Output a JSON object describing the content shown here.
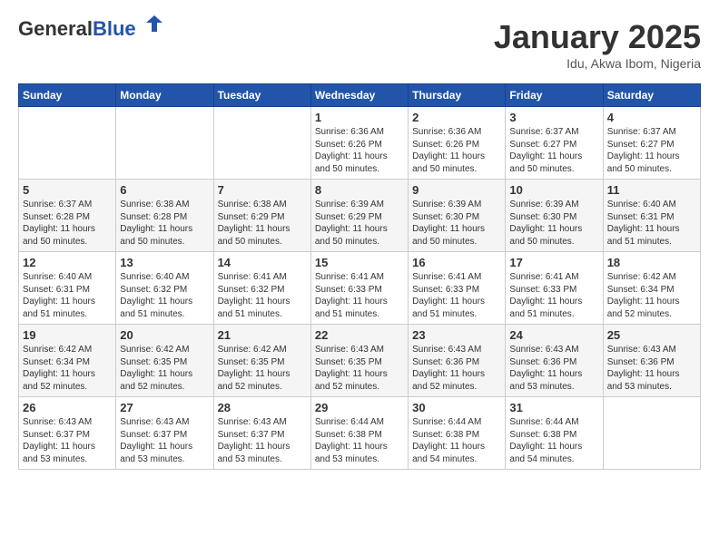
{
  "header": {
    "logo_general": "General",
    "logo_blue": "Blue",
    "title": "January 2025",
    "subtitle": "Idu, Akwa Ibom, Nigeria"
  },
  "weekdays": [
    "Sunday",
    "Monday",
    "Tuesday",
    "Wednesday",
    "Thursday",
    "Friday",
    "Saturday"
  ],
  "rows": [
    [
      null,
      null,
      null,
      {
        "day": "1",
        "sunrise": "6:36 AM",
        "sunset": "6:26 PM",
        "daylight": "11 hours and 50 minutes."
      },
      {
        "day": "2",
        "sunrise": "6:36 AM",
        "sunset": "6:26 PM",
        "daylight": "11 hours and 50 minutes."
      },
      {
        "day": "3",
        "sunrise": "6:37 AM",
        "sunset": "6:27 PM",
        "daylight": "11 hours and 50 minutes."
      },
      {
        "day": "4",
        "sunrise": "6:37 AM",
        "sunset": "6:27 PM",
        "daylight": "11 hours and 50 minutes."
      }
    ],
    [
      {
        "day": "5",
        "sunrise": "6:37 AM",
        "sunset": "6:28 PM",
        "daylight": "11 hours and 50 minutes."
      },
      {
        "day": "6",
        "sunrise": "6:38 AM",
        "sunset": "6:28 PM",
        "daylight": "11 hours and 50 minutes."
      },
      {
        "day": "7",
        "sunrise": "6:38 AM",
        "sunset": "6:29 PM",
        "daylight": "11 hours and 50 minutes."
      },
      {
        "day": "8",
        "sunrise": "6:39 AM",
        "sunset": "6:29 PM",
        "daylight": "11 hours and 50 minutes."
      },
      {
        "day": "9",
        "sunrise": "6:39 AM",
        "sunset": "6:30 PM",
        "daylight": "11 hours and 50 minutes."
      },
      {
        "day": "10",
        "sunrise": "6:39 AM",
        "sunset": "6:30 PM",
        "daylight": "11 hours and 50 minutes."
      },
      {
        "day": "11",
        "sunrise": "6:40 AM",
        "sunset": "6:31 PM",
        "daylight": "11 hours and 51 minutes."
      }
    ],
    [
      {
        "day": "12",
        "sunrise": "6:40 AM",
        "sunset": "6:31 PM",
        "daylight": "11 hours and 51 minutes."
      },
      {
        "day": "13",
        "sunrise": "6:40 AM",
        "sunset": "6:32 PM",
        "daylight": "11 hours and 51 minutes."
      },
      {
        "day": "14",
        "sunrise": "6:41 AM",
        "sunset": "6:32 PM",
        "daylight": "11 hours and 51 minutes."
      },
      {
        "day": "15",
        "sunrise": "6:41 AM",
        "sunset": "6:33 PM",
        "daylight": "11 hours and 51 minutes."
      },
      {
        "day": "16",
        "sunrise": "6:41 AM",
        "sunset": "6:33 PM",
        "daylight": "11 hours and 51 minutes."
      },
      {
        "day": "17",
        "sunrise": "6:41 AM",
        "sunset": "6:33 PM",
        "daylight": "11 hours and 51 minutes."
      },
      {
        "day": "18",
        "sunrise": "6:42 AM",
        "sunset": "6:34 PM",
        "daylight": "11 hours and 52 minutes."
      }
    ],
    [
      {
        "day": "19",
        "sunrise": "6:42 AM",
        "sunset": "6:34 PM",
        "daylight": "11 hours and 52 minutes."
      },
      {
        "day": "20",
        "sunrise": "6:42 AM",
        "sunset": "6:35 PM",
        "daylight": "11 hours and 52 minutes."
      },
      {
        "day": "21",
        "sunrise": "6:42 AM",
        "sunset": "6:35 PM",
        "daylight": "11 hours and 52 minutes."
      },
      {
        "day": "22",
        "sunrise": "6:43 AM",
        "sunset": "6:35 PM",
        "daylight": "11 hours and 52 minutes."
      },
      {
        "day": "23",
        "sunrise": "6:43 AM",
        "sunset": "6:36 PM",
        "daylight": "11 hours and 52 minutes."
      },
      {
        "day": "24",
        "sunrise": "6:43 AM",
        "sunset": "6:36 PM",
        "daylight": "11 hours and 53 minutes."
      },
      {
        "day": "25",
        "sunrise": "6:43 AM",
        "sunset": "6:36 PM",
        "daylight": "11 hours and 53 minutes."
      }
    ],
    [
      {
        "day": "26",
        "sunrise": "6:43 AM",
        "sunset": "6:37 PM",
        "daylight": "11 hours and 53 minutes."
      },
      {
        "day": "27",
        "sunrise": "6:43 AM",
        "sunset": "6:37 PM",
        "daylight": "11 hours and 53 minutes."
      },
      {
        "day": "28",
        "sunrise": "6:43 AM",
        "sunset": "6:37 PM",
        "daylight": "11 hours and 53 minutes."
      },
      {
        "day": "29",
        "sunrise": "6:44 AM",
        "sunset": "6:38 PM",
        "daylight": "11 hours and 53 minutes."
      },
      {
        "day": "30",
        "sunrise": "6:44 AM",
        "sunset": "6:38 PM",
        "daylight": "11 hours and 54 minutes."
      },
      {
        "day": "31",
        "sunrise": "6:44 AM",
        "sunset": "6:38 PM",
        "daylight": "11 hours and 54 minutes."
      },
      null
    ]
  ],
  "labels": {
    "sunrise": "Sunrise: ",
    "sunset": "Sunset: ",
    "daylight": "Daylight hours"
  }
}
